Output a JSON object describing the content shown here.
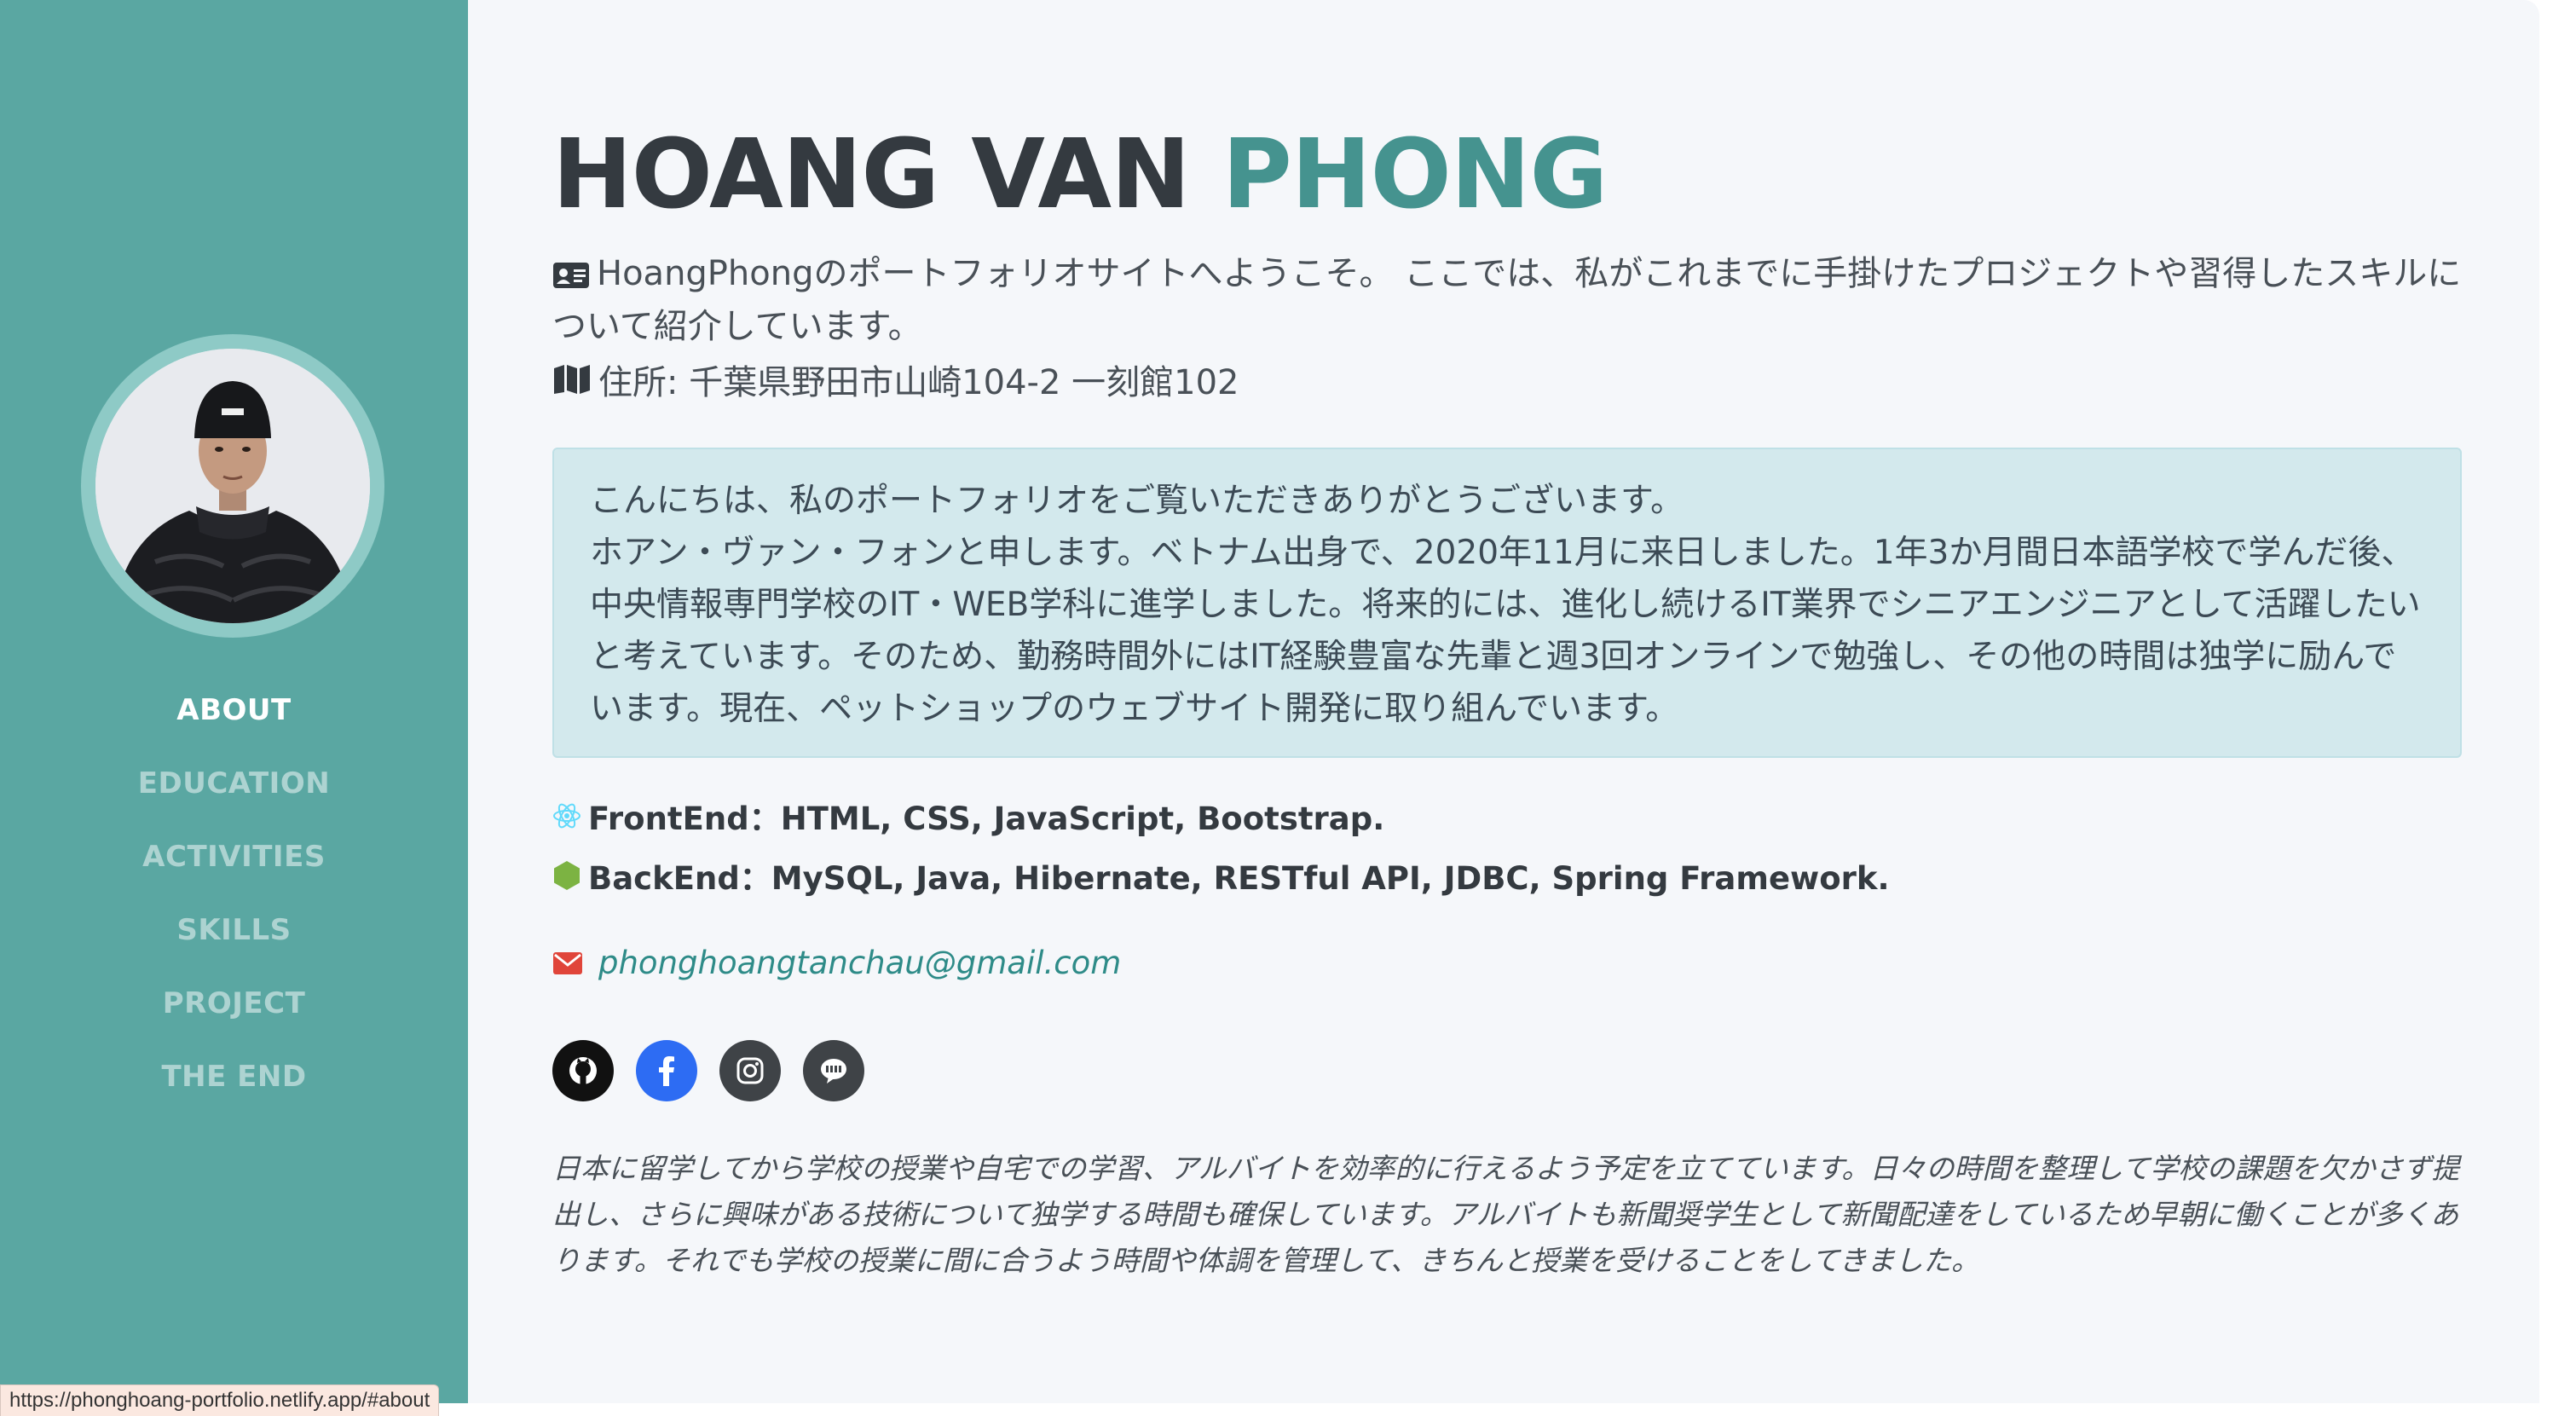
{
  "sidebar": {
    "nav": [
      {
        "label": "ABOUT",
        "active": true
      },
      {
        "label": "EDUCATION",
        "active": false
      },
      {
        "label": "ACTIVITIES",
        "active": false
      },
      {
        "label": "SKILLS",
        "active": false
      },
      {
        "label": "PROJECT",
        "active": false
      },
      {
        "label": "THE END",
        "active": false
      }
    ]
  },
  "header": {
    "first_name": "HOANG VAN",
    "last_name": "PHONG"
  },
  "intro": {
    "icon": "id-card-icon",
    "text": "HoangPhongのポートフォリオサイトへようこそ。 ここでは、私がこれまでに手掛けたプロジェクトや習得したスキルについて紹介しています。"
  },
  "address": {
    "icon": "map-icon",
    "text": "住所: 千葉県野田市山崎104-2 一刻館102"
  },
  "about_box": {
    "line1": "こんにちは、私のポートフォリオをご覧いただきありがとうございます。",
    "line2": "ホアン・ヴァン・フォンと申します。ベトナム出身で、2020年11月に来日しました。1年3か月間日本語学校で学んだ後、中央情報専門学校のIT・WEB学科に進学しました。将来的には、進化し続けるIT業界でシニアエンジニアとして活躍したいと考えています。そのため、勤務時間外にはIT経験豊富な先輩と週3回オンラインで勉強し、その他の時間は独学に励んでいます。現在、ペットショップのウェブサイト開発に取り組んでいます。"
  },
  "skills": {
    "frontend": "FrontEnd：HTML, CSS, JavaScript, Bootstrap.",
    "backend": "BackEnd：MySQL, Java, Hibernate, RESTful API, JDBC, Spring Framework."
  },
  "contact": {
    "email": "phonghoangtanchau@gmail.com"
  },
  "social": [
    "github-icon",
    "facebook-icon",
    "instagram-icon",
    "line-icon"
  ],
  "footer": {
    "text": "日本に留学してから学校の授業や自宅での学習、アルバイトを効率的に行えるよう予定を立てています。日々の時間を整理して学校の課題を欠かさず提出し、さらに興味がある技術について独学する時間も確保しています。アルバイトも新聞奨学生として新聞配達をしているため早朝に働くことが多くあります。それでも学校の授業に間に合うよう時間や体調を管理して、きちんと授業を受けることをしてきました。"
  },
  "status_bar": {
    "url": "https://phonghoang-portfolio.netlify.app/#about"
  },
  "colors": {
    "sidebar": "#5aa7a2",
    "accent": "#45938f",
    "box": "#d3e9ed",
    "email": "#2e8b88",
    "mail_icon": "#e0453a",
    "facebook": "#2d6cf3",
    "react": "#61dafb",
    "node": "#7cb342"
  }
}
